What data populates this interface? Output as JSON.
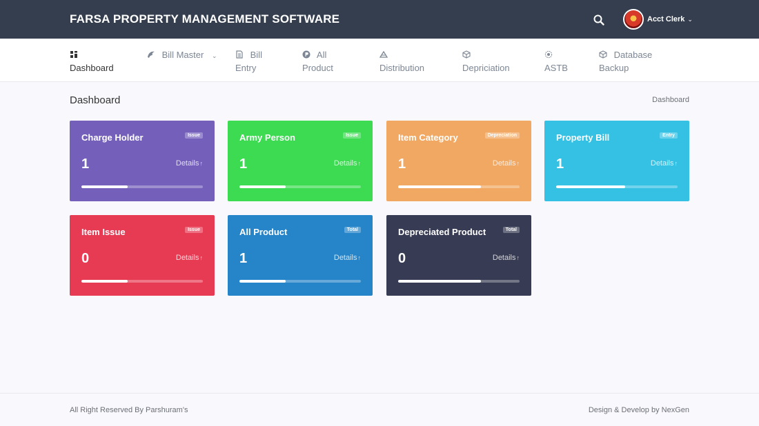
{
  "header": {
    "brand": "FARSA PROPERTY MANAGEMENT SOFTWARE",
    "search_icon": "search-icon",
    "user": {
      "name": "Acct Clerk",
      "chevron": "⌄"
    }
  },
  "nav": {
    "items": [
      {
        "icon": "grid-icon",
        "line1": "",
        "line2": "Dashboard",
        "active": true
      },
      {
        "icon": "bird-icon",
        "line1": "Bill Master",
        "line2": "",
        "chevron": "⌄"
      },
      {
        "icon": "file-icon",
        "line1": "Bill",
        "line2": "Entry"
      },
      {
        "icon": "product-icon",
        "line1": "All",
        "line2": "Product"
      },
      {
        "icon": "distribution-icon",
        "line1": "",
        "line2": "Distribution"
      },
      {
        "icon": "cube-icon",
        "line1": "",
        "line2": "Depriciation"
      },
      {
        "icon": "gear-icon",
        "line1": "",
        "line2": "ASTB"
      },
      {
        "icon": "database-icon",
        "line1": "Database",
        "line2": "Backup"
      }
    ]
  },
  "page": {
    "title": "Dashboard",
    "breadcrumb": "Dashboard"
  },
  "cards": [
    {
      "title": "Charge Holder",
      "badge": "Issue",
      "count": "1",
      "details": "Details",
      "progress": 0.38,
      "color": "#7460bb"
    },
    {
      "title": "Army Person",
      "badge": "Issue",
      "count": "1",
      "details": "Details",
      "progress": 0.38,
      "color": "#3cdb52"
    },
    {
      "title": "Item Category",
      "badge": "Depreciation",
      "count": "1",
      "details": "Details",
      "progress": 0.68,
      "color": "#f1a863"
    },
    {
      "title": "Property Bill",
      "badge": "Entry",
      "count": "1",
      "details": "Details",
      "progress": 0.57,
      "color": "#35c1e4"
    },
    {
      "title": "Item Issue",
      "badge": "Issue",
      "count": "0",
      "details": "Details",
      "progress": 0.38,
      "color": "#e73b54"
    },
    {
      "title": "All Product",
      "badge": "Total",
      "count": "1",
      "details": "Details",
      "progress": 0.38,
      "color": "#2685c8"
    },
    {
      "title": "Depreciated Product",
      "badge": "Total",
      "count": "0",
      "details": "Details",
      "progress": 0.68,
      "color": "#373b53"
    }
  ],
  "footer": {
    "left": "All Right Reserved By Parshuram's",
    "right": "Design & Develop by NexGen"
  }
}
